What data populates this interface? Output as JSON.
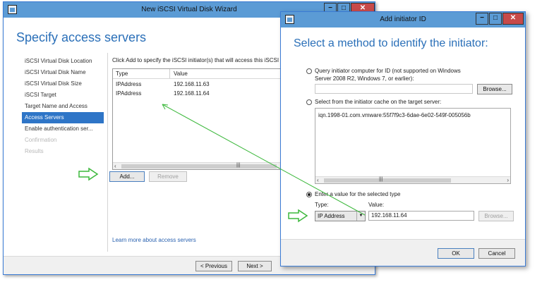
{
  "main_window": {
    "title": "New iSCSI Virtual Disk Wizard",
    "heading": "Specify access servers",
    "sidebar": [
      {
        "label": "iSCSI Virtual Disk Location",
        "state": "normal"
      },
      {
        "label": "iSCSI Virtual Disk Name",
        "state": "normal"
      },
      {
        "label": "iSCSI Virtual Disk Size",
        "state": "normal"
      },
      {
        "label": "iSCSI Target",
        "state": "normal"
      },
      {
        "label": "Target Name and Access",
        "state": "normal"
      },
      {
        "label": "Access Servers",
        "state": "active"
      },
      {
        "label": "Enable authentication ser...",
        "state": "normal"
      },
      {
        "label": "Confirmation",
        "state": "disabled"
      },
      {
        "label": "Results",
        "state": "disabled"
      }
    ],
    "instruction": "Click Add to specify the iSCSI initiator(s) that will access this iSCSI vi",
    "table": {
      "columns": [
        "Type",
        "Value"
      ],
      "rows": [
        {
          "type": "IPAddress",
          "value": "192.168.11.63"
        },
        {
          "type": "IPAddress",
          "value": "192.168.11.64"
        }
      ]
    },
    "add_button": "Add...",
    "remove_button": "Remove",
    "learn_more_link": "Learn more about access servers",
    "previous_button": "< Previous",
    "next_button": "Next >",
    "controls": {
      "minimize": "−",
      "maximize": "□",
      "close": "✕"
    }
  },
  "dialog": {
    "title": "Add initiator ID",
    "heading": "Select a method to identify the initiator:",
    "option_query": "Query initiator computer for ID (not supported on Windows Server 2008 R2, Windows 7, or earlier):",
    "option_query_line1": "Query initiator computer for ID (not supported on Windows",
    "option_query_line2": "Server 2008 R2, Windows 7, or earlier):",
    "query_value": "",
    "browse_button": "Browse...",
    "option_cache": "Select from the initiator cache on the target server:",
    "cache_items": [
      "iqn.1998-01.com.vmware:55f7f9c3-6dae-6e02-549f-005056b"
    ],
    "option_enter": "Enter a value for the selected type",
    "type_label": "Type:",
    "value_label": "Value:",
    "type_selected": "IP Address",
    "value_input": "192.168.11.64",
    "browse_disabled_button": "Browse...",
    "ok_button": "OK",
    "cancel_button": "Cancel",
    "selected_option": "enter",
    "controls": {
      "minimize": "−",
      "maximize": "□",
      "close": "✕"
    }
  },
  "colors": {
    "titlebar": "#5b9bd5",
    "accent": "#2e75c7",
    "heading": "#2a6fb8",
    "close": "#c74a4a",
    "annotation": "#3cb83c"
  }
}
